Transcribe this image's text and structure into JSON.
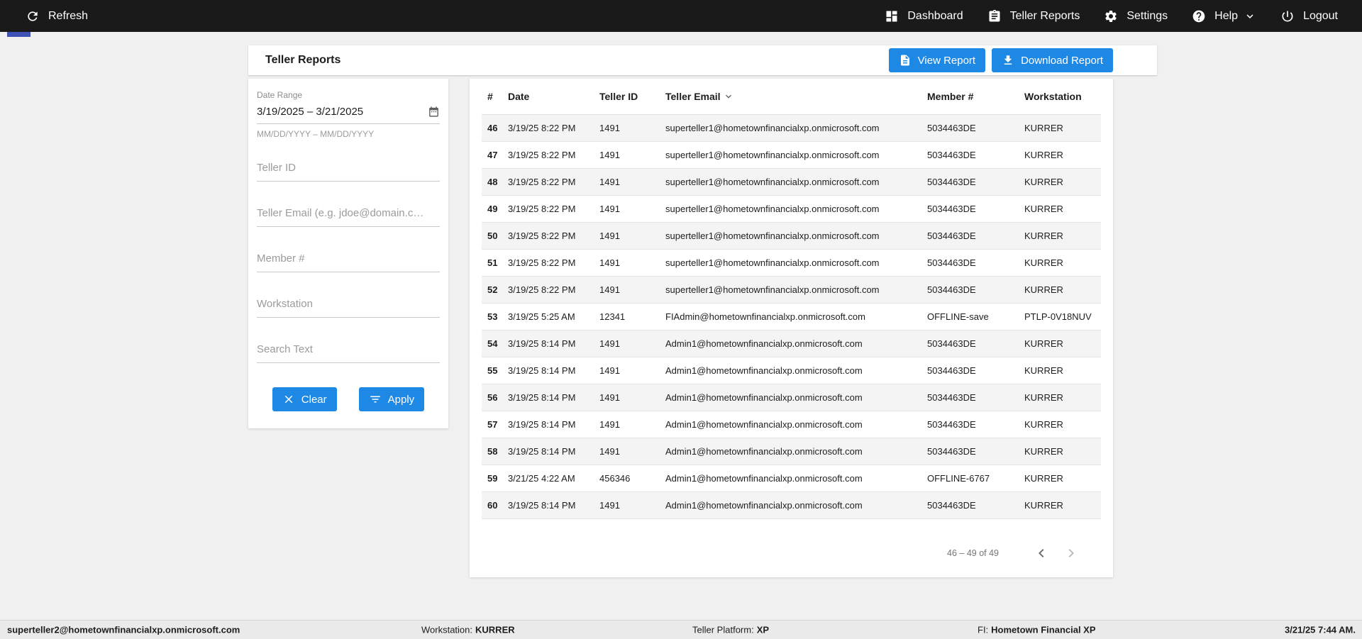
{
  "topbar": {
    "refresh_label": "Refresh",
    "nav": [
      {
        "label": "Dashboard"
      },
      {
        "label": "Teller Reports"
      },
      {
        "label": "Settings"
      },
      {
        "label": "Help"
      },
      {
        "label": "Logout"
      }
    ]
  },
  "page": {
    "title": "Teller Reports",
    "view_report_label": "View Report",
    "download_report_label": "Download Report"
  },
  "filters": {
    "date_range": {
      "label": "Date Range",
      "value": "3/19/2025 – 3/21/2025",
      "hint": "MM/DD/YYYY – MM/DD/YYYY"
    },
    "teller_id_placeholder": "Teller ID",
    "teller_email_placeholder": "Teller Email (e.g. jdoe@domain.c…",
    "member_placeholder": "Member #",
    "workstation_placeholder": "Workstation",
    "search_placeholder": "Search Text",
    "clear_label": "Clear",
    "apply_label": "Apply"
  },
  "table": {
    "columns": {
      "num": "#",
      "date": "Date",
      "teller_id": "Teller ID",
      "teller_email": "Teller Email",
      "member": "Member #",
      "workstation": "Workstation"
    },
    "sorted_column": "teller_email",
    "rows": [
      {
        "num": "46",
        "date": "3/19/25 8:22 PM",
        "teller_id": "1491",
        "teller_email": "superteller1@hometownfinancialxp.onmicrosoft.com",
        "member": "5034463DE",
        "workstation": "KURRER"
      },
      {
        "num": "47",
        "date": "3/19/25 8:22 PM",
        "teller_id": "1491",
        "teller_email": "superteller1@hometownfinancialxp.onmicrosoft.com",
        "member": "5034463DE",
        "workstation": "KURRER"
      },
      {
        "num": "48",
        "date": "3/19/25 8:22 PM",
        "teller_id": "1491",
        "teller_email": "superteller1@hometownfinancialxp.onmicrosoft.com",
        "member": "5034463DE",
        "workstation": "KURRER"
      },
      {
        "num": "49",
        "date": "3/19/25 8:22 PM",
        "teller_id": "1491",
        "teller_email": "superteller1@hometownfinancialxp.onmicrosoft.com",
        "member": "5034463DE",
        "workstation": "KURRER"
      },
      {
        "num": "50",
        "date": "3/19/25 8:22 PM",
        "teller_id": "1491",
        "teller_email": "superteller1@hometownfinancialxp.onmicrosoft.com",
        "member": "5034463DE",
        "workstation": "KURRER"
      },
      {
        "num": "51",
        "date": "3/19/25 8:22 PM",
        "teller_id": "1491",
        "teller_email": "superteller1@hometownfinancialxp.onmicrosoft.com",
        "member": "5034463DE",
        "workstation": "KURRER"
      },
      {
        "num": "52",
        "date": "3/19/25 8:22 PM",
        "teller_id": "1491",
        "teller_email": "superteller1@hometownfinancialxp.onmicrosoft.com",
        "member": "5034463DE",
        "workstation": "KURRER"
      },
      {
        "num": "53",
        "date": "3/19/25 5:25 AM",
        "teller_id": "12341",
        "teller_email": "FIAdmin@hometownfinancialxp.onmicrosoft.com",
        "member": "OFFLINE-save",
        "workstation": "PTLP-0V18NUV"
      },
      {
        "num": "54",
        "date": "3/19/25 8:14 PM",
        "teller_id": "1491",
        "teller_email": "Admin1@hometownfinancialxp.onmicrosoft.com",
        "member": "5034463DE",
        "workstation": "KURRER"
      },
      {
        "num": "55",
        "date": "3/19/25 8:14 PM",
        "teller_id": "1491",
        "teller_email": "Admin1@hometownfinancialxp.onmicrosoft.com",
        "member": "5034463DE",
        "workstation": "KURRER"
      },
      {
        "num": "56",
        "date": "3/19/25 8:14 PM",
        "teller_id": "1491",
        "teller_email": "Admin1@hometownfinancialxp.onmicrosoft.com",
        "member": "5034463DE",
        "workstation": "KURRER"
      },
      {
        "num": "57",
        "date": "3/19/25 8:14 PM",
        "teller_id": "1491",
        "teller_email": "Admin1@hometownfinancialxp.onmicrosoft.com",
        "member": "5034463DE",
        "workstation": "KURRER"
      },
      {
        "num": "58",
        "date": "3/19/25 8:14 PM",
        "teller_id": "1491",
        "teller_email": "Admin1@hometownfinancialxp.onmicrosoft.com",
        "member": "5034463DE",
        "workstation": "KURRER"
      },
      {
        "num": "59",
        "date": "3/21/25 4:22 AM",
        "teller_id": "456346",
        "teller_email": "Admin1@hometownfinancialxp.onmicrosoft.com",
        "member": "OFFLINE-6767",
        "workstation": "KURRER"
      },
      {
        "num": "60",
        "date": "3/19/25 8:14 PM",
        "teller_id": "1491",
        "teller_email": "Admin1@hometownfinancialxp.onmicrosoft.com",
        "member": "5034463DE",
        "workstation": "KURRER"
      }
    ],
    "pagination": {
      "range_text": "46 – 49 of 49"
    }
  },
  "statusbar": {
    "user_email": "superteller2@hometownfinancialxp.onmicrosoft.com",
    "workstation_label": "Workstation:",
    "workstation_value": "KURRER",
    "platform_label": "Teller Platform:",
    "platform_value": "XP",
    "fi_label": "FI:",
    "fi_value": "Hometown Financial XP",
    "datetime": "3/21/25 7:44 AM."
  },
  "colors": {
    "accent_blue": "#1e88e5",
    "topbar_bg": "#1a1a1a",
    "progress_indigo": "#3f51b5"
  }
}
